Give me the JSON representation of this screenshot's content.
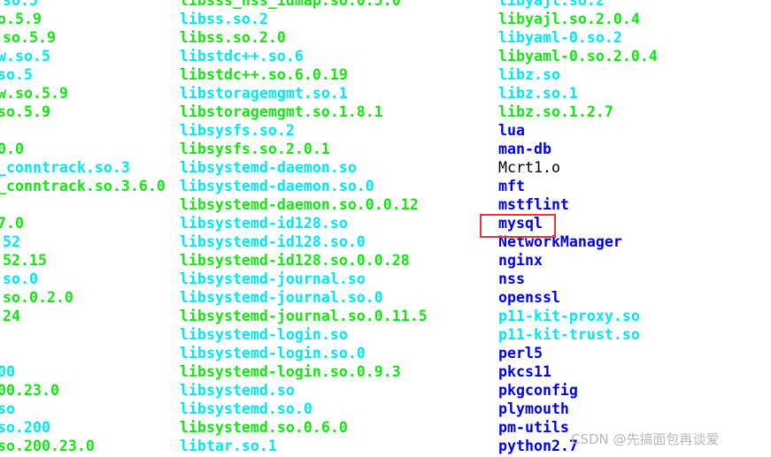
{
  "terminal": {
    "colors": {
      "executable_or_file": "#14e614",
      "symlink": "#00e8f0",
      "directory": "#0000e6",
      "plain_file": "#000000",
      "highlight_box": "#e8333a"
    },
    "columns": [
      {
        "items": [
          {
            "name": "so.5",
            "type": "cyan"
          },
          {
            "name": "o.5.9",
            "type": "green"
          },
          {
            "name": "so.5.9",
            "type": "green"
          },
          {
            "name": "w.so.5",
            "type": "cyan"
          },
          {
            "name": "so.5",
            "type": "cyan"
          },
          {
            "name": "w.so.5.9",
            "type": "green"
          },
          {
            "name": "so.5.9",
            "type": "green"
          },
          {
            "name": "",
            "type": "green"
          },
          {
            "name": "0.0",
            "type": "green"
          },
          {
            "name": "_conntrack.so.3",
            "type": "cyan"
          },
          {
            "name": "_conntrack.so.3.6.0",
            "type": "green"
          },
          {
            "name": "",
            "type": "green"
          },
          {
            "name": "7.0",
            "type": "green"
          },
          {
            "name": "52",
            "type": "cyan"
          },
          {
            "name": "52.15",
            "type": "green"
          },
          {
            "name": "so.0",
            "type": "cyan"
          },
          {
            "name": "so.0.2.0",
            "type": "green"
          },
          {
            "name": "24",
            "type": "green"
          },
          {
            "name": "",
            "type": "green"
          },
          {
            "name": "",
            "type": "green"
          },
          {
            "name": "00",
            "type": "cyan"
          },
          {
            "name": "00.23.0",
            "type": "green"
          },
          {
            "name": "so",
            "type": "cyan"
          },
          {
            "name": "so.200",
            "type": "cyan"
          },
          {
            "name": "so.200.23.0",
            "type": "green"
          }
        ]
      },
      {
        "items": [
          {
            "name": "libsss_nss_idmap.so.0.5.0",
            "type": "green"
          },
          {
            "name": "libss.so.2",
            "type": "cyan"
          },
          {
            "name": "libss.so.2.0",
            "type": "green"
          },
          {
            "name": "libstdc++.so.6",
            "type": "cyan"
          },
          {
            "name": "libstdc++.so.6.0.19",
            "type": "green"
          },
          {
            "name": "libstoragemgmt.so.1",
            "type": "cyan"
          },
          {
            "name": "libstoragemgmt.so.1.8.1",
            "type": "green"
          },
          {
            "name": "libsysfs.so.2",
            "type": "cyan"
          },
          {
            "name": "libsysfs.so.2.0.1",
            "type": "green"
          },
          {
            "name": "libsystemd-daemon.so",
            "type": "cyan"
          },
          {
            "name": "libsystemd-daemon.so.0",
            "type": "cyan"
          },
          {
            "name": "libsystemd-daemon.so.0.0.12",
            "type": "green"
          },
          {
            "name": "libsystemd-id128.so",
            "type": "cyan"
          },
          {
            "name": "libsystemd-id128.so.0",
            "type": "cyan"
          },
          {
            "name": "libsystemd-id128.so.0.0.28",
            "type": "green"
          },
          {
            "name": "libsystemd-journal.so",
            "type": "cyan"
          },
          {
            "name": "libsystemd-journal.so.0",
            "type": "cyan"
          },
          {
            "name": "libsystemd-journal.so.0.11.5",
            "type": "green"
          },
          {
            "name": "libsystemd-login.so",
            "type": "cyan"
          },
          {
            "name": "libsystemd-login.so.0",
            "type": "cyan"
          },
          {
            "name": "libsystemd-login.so.0.9.3",
            "type": "green"
          },
          {
            "name": "libsystemd.so",
            "type": "cyan"
          },
          {
            "name": "libsystemd.so.0",
            "type": "cyan"
          },
          {
            "name": "libsystemd.so.0.6.0",
            "type": "green"
          },
          {
            "name": "libtar.so.1",
            "type": "cyan"
          }
        ]
      },
      {
        "items": [
          {
            "name": "libyajl.so.2",
            "type": "cyan"
          },
          {
            "name": "libyajl.so.2.0.4",
            "type": "green"
          },
          {
            "name": "libyaml-0.so.2",
            "type": "cyan"
          },
          {
            "name": "libyaml-0.so.2.0.4",
            "type": "green"
          },
          {
            "name": "libz.so",
            "type": "cyan"
          },
          {
            "name": "libz.so.1",
            "type": "cyan"
          },
          {
            "name": "libz.so.1.2.7",
            "type": "green"
          },
          {
            "name": "lua",
            "type": "blue"
          },
          {
            "name": "man-db",
            "type": "blue"
          },
          {
            "name": "Mcrt1.o",
            "type": "plain"
          },
          {
            "name": "mft",
            "type": "blue"
          },
          {
            "name": "mstflint",
            "type": "blue"
          },
          {
            "name": "mysql",
            "type": "blue"
          },
          {
            "name": "NetworkManager",
            "type": "blue"
          },
          {
            "name": "nginx",
            "type": "blue"
          },
          {
            "name": "nss",
            "type": "blue"
          },
          {
            "name": "openssl",
            "type": "blue"
          },
          {
            "name": "p11-kit-proxy.so",
            "type": "cyan"
          },
          {
            "name": "p11-kit-trust.so",
            "type": "cyan"
          },
          {
            "name": "perl5",
            "type": "blue"
          },
          {
            "name": "pkcs11",
            "type": "blue"
          },
          {
            "name": "pkgconfig",
            "type": "blue"
          },
          {
            "name": "plymouth",
            "type": "blue"
          },
          {
            "name": "pm-utils",
            "type": "blue"
          },
          {
            "name": "python2.7",
            "type": "blue"
          }
        ]
      }
    ],
    "highlighted_item": "mysql"
  },
  "watermark": "CSDN @先搞面包再谈爱"
}
